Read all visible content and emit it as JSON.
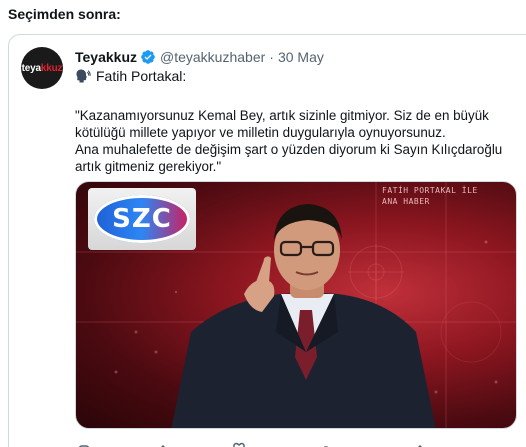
{
  "heading": "Seçimden sonra:",
  "tweet": {
    "avatar_text_prefix": "teya",
    "avatar_text_suffix": "kkuz",
    "display_name": "Teyakkuz",
    "handle": "@teyakkuzhaber",
    "separator": "·",
    "date": "30 May",
    "speaker_line": "Fatih Portakal:",
    "text_lines": [
      "\"Kazanamıyorsunuz Kemal Bey, artık sizinle gitmiyor. Siz de en büyük",
      "kötülüğü millete yapıyor ve milletin duygularıyla oynuyorsunuz.",
      "Ana muhalefette de değişim şart o yüzden diyorum ki Sayın Kılıçdaroğlu",
      "artık gitmeniz gerekiyor.\""
    ]
  },
  "media": {
    "channel_logo": "SZC",
    "overlay_line1": "FATİH PORTAKAL İLE",
    "overlay_line2": "ANA HABER"
  },
  "colors": {
    "verified": "#1d9bf0",
    "text": "#0f1419",
    "muted": "#536471",
    "border": "#cfd9de"
  },
  "icons": {
    "verified": "verified-badge-icon",
    "speaker": "speaking-head-icon"
  }
}
